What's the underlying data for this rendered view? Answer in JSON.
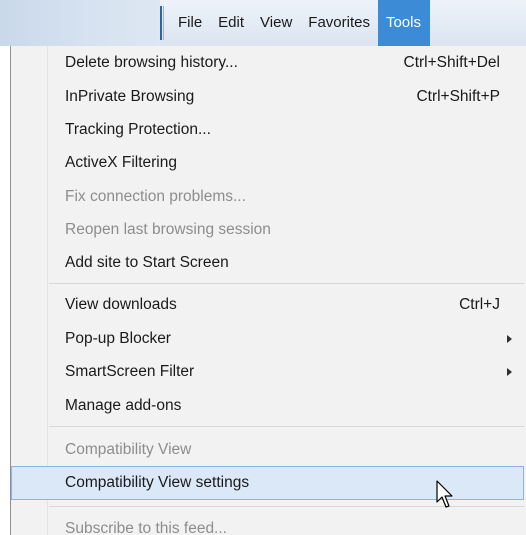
{
  "menubar": {
    "items": [
      {
        "label": "File"
      },
      {
        "label": "Edit"
      },
      {
        "label": "View"
      },
      {
        "label": "Favorites"
      },
      {
        "label": "Tools",
        "active": true
      }
    ]
  },
  "tools_menu": {
    "items": [
      {
        "label": "Delete browsing history...",
        "shortcut": "Ctrl+Shift+Del",
        "enabled": true
      },
      {
        "label": "InPrivate Browsing",
        "shortcut": "Ctrl+Shift+P",
        "enabled": true
      },
      {
        "label": "Tracking Protection...",
        "enabled": true
      },
      {
        "label": "ActiveX Filtering",
        "enabled": true
      },
      {
        "label": "Fix connection problems...",
        "enabled": false
      },
      {
        "label": "Reopen last browsing session",
        "enabled": false
      },
      {
        "label": "Add site to Start Screen",
        "enabled": true
      },
      {
        "label": "View downloads",
        "shortcut": "Ctrl+J",
        "enabled": true
      },
      {
        "label": "Pop-up Blocker",
        "submenu": true,
        "enabled": true
      },
      {
        "label": "SmartScreen Filter",
        "submenu": true,
        "enabled": true
      },
      {
        "label": "Manage add-ons",
        "enabled": true
      },
      {
        "label": "Compatibility View",
        "enabled": false
      },
      {
        "label": "Compatibility View settings",
        "enabled": true,
        "highlighted": true
      },
      {
        "label": "Subscribe to this feed...",
        "enabled": false
      }
    ]
  },
  "colors": {
    "menu_active_bg": "#3c8bd6",
    "highlight_bg": "#dbe8f8",
    "highlight_border": "#8db2e3",
    "disabled_text": "#8d8d8d"
  }
}
